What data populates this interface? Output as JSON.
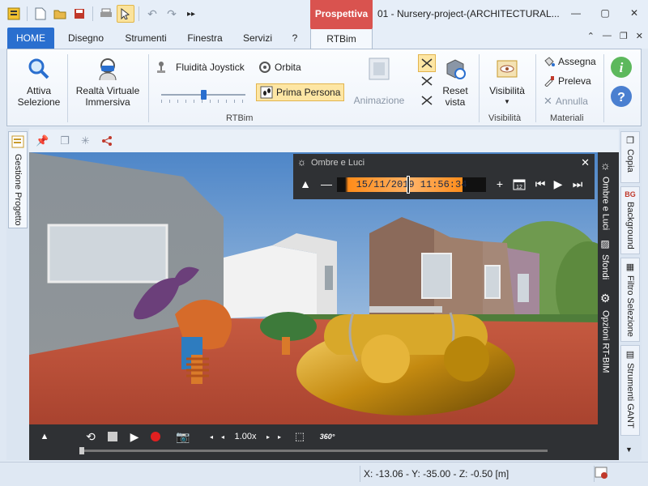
{
  "titlebar": {
    "context_tab": "Prospettiva",
    "window_title": "01 - Nursery-project-(ARCHITECTURAL..."
  },
  "tabs": [
    "HOME",
    "Disegno",
    "Strumenti",
    "Finestra",
    "Servizi",
    "?",
    "RTBim"
  ],
  "ribbon": {
    "attiva_selezione": "Attiva\nSelezione",
    "realta_virtuale": "Realtà Virtuale\nImmersiva",
    "fluidita_joystick": "Fluidità Joystick",
    "joystick_level": 0.5,
    "orbita": "Orbita",
    "prima_persona": "Prima Persona",
    "animazione": "Animazione",
    "reset_vista": "Reset\nvista",
    "group_rtbim": "RTBim",
    "visibilita_btn": "Visibilità",
    "group_visibilita": "Visibilità",
    "assegna": "Assegna",
    "preleva": "Preleva",
    "annulla": "Annulla",
    "group_materiali": "Materiali"
  },
  "left_panel": {
    "gestione_progetto": "Gestione Progetto"
  },
  "right_tabs": [
    "Copia",
    "Background",
    "Filtro Selezione",
    "Strumenti GANT"
  ],
  "rt_panel": [
    "Ombre e Luci",
    "Sfondi",
    "Opzioni RT-BIM"
  ],
  "popup": {
    "title": "Ombre e Luci",
    "datetime": "15/11/2019 11:56:34"
  },
  "playback": {
    "speed": "1.00x",
    "progress": 0
  },
  "status": {
    "coords": "X: -13.06 - Y: -35.00 - Z: -0.50 [m]"
  },
  "colors": {
    "accent": "#2a6fcf",
    "context": "#d9534f",
    "panel_dark": "#2f3134",
    "time_orange": "#ff8c1a"
  }
}
